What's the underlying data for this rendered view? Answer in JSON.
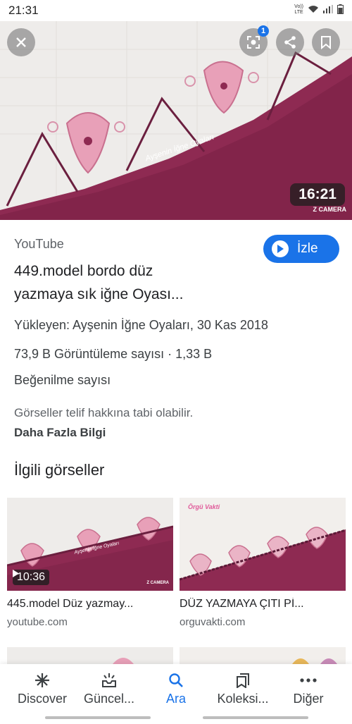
{
  "status_bar": {
    "time": "21:31",
    "network": "LTE",
    "carrier_tag": "Vo))"
  },
  "hero": {
    "duration": "16:21",
    "watermark": "Z CAMERA",
    "overlay_text": "Ayşenin İğne Oyaları",
    "lens_badge": "1"
  },
  "result": {
    "source": "YouTube",
    "visit_label": "İzle",
    "title_line1": "449.model bordo düz",
    "title_line2": "yazmaya sık iğne Oyası...",
    "uploader": "Yükleyen: Ayşenin İğne Oyaları, 30 Kas 2018",
    "stats_line1": "73,9 B Görüntüleme sayısı · 1,33 B",
    "stats_line2": "Beğenilme sayısı",
    "copyright": "Görseller telif hakkına tabi olabilir.",
    "more_info": "Daha Fazla Bilgi"
  },
  "related": {
    "heading": "İlgili görseller",
    "items": [
      {
        "title": "445.model Düz yazmay...",
        "domain": "youtube.com",
        "duration": "10:36",
        "overlay": "Ayşenin İğne Oyaları",
        "watermark": "Z CAMERA"
      },
      {
        "title": "DÜZ YAZMAYA ÇITI Pİ...",
        "domain": "orguvakti.com",
        "overlay": "Örgü Vakti"
      }
    ]
  },
  "bottom_nav": {
    "items": [
      {
        "label": "Discover",
        "icon": "asterisk-icon"
      },
      {
        "label": "Güncel...",
        "icon": "updates-icon"
      },
      {
        "label": "Ara",
        "icon": "search-icon"
      },
      {
        "label": "Koleksi...",
        "icon": "collections-icon"
      },
      {
        "label": "Diğer",
        "icon": "more-dots-icon"
      }
    ],
    "active_index": 2
  },
  "colors": {
    "accent": "#1a73e8",
    "fabric": "#8e2a52",
    "lace": "#e8a0b8"
  }
}
